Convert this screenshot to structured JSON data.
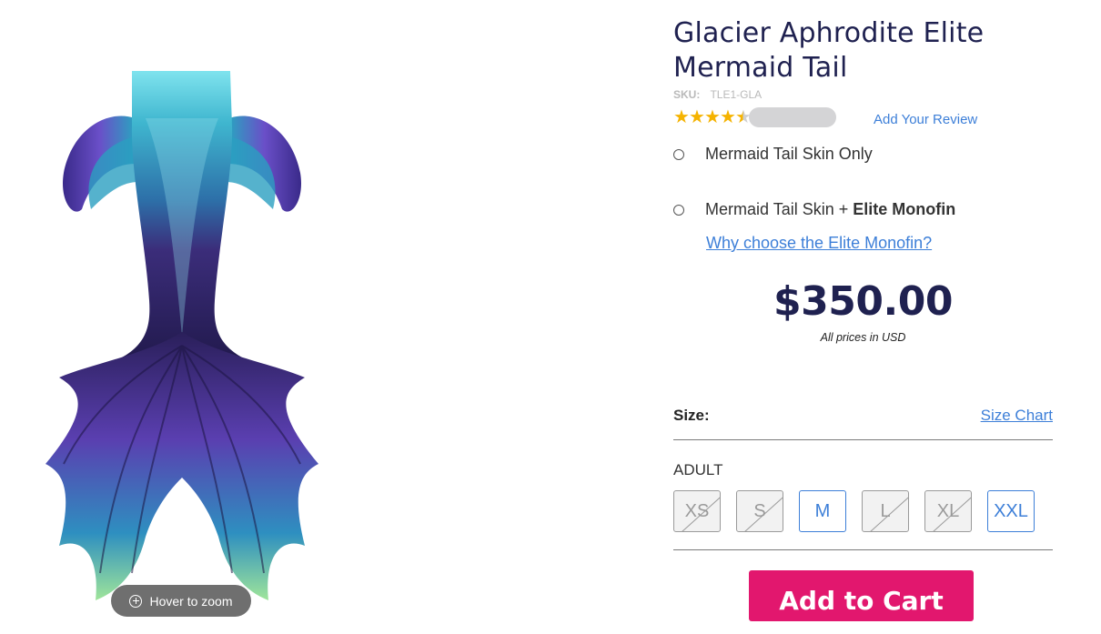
{
  "product": {
    "title": "Glacier Aphrodite Elite Mermaid Tail",
    "sku_label": "SKU:",
    "sku_value": "TLE1-GLA",
    "rating": 4.5,
    "add_review": "Add Your Review"
  },
  "gallery": {
    "zoom_hint": "Hover to zoom",
    "zoom_icon": "zoom-in-icon"
  },
  "options": {
    "option1": "Mermaid Tail Skin Only",
    "option2_prefix": "Mermaid Tail Skin + ",
    "option2_bold": "Elite Monofin",
    "why_link": "Why choose the Elite Monofin?"
  },
  "pricing": {
    "price": "$350.00",
    "note": "All prices in USD"
  },
  "size": {
    "label": "Size:",
    "chart_link": "Size Chart",
    "group": "ADULT",
    "buttons": [
      {
        "label": "XS",
        "available": false
      },
      {
        "label": "S",
        "available": false
      },
      {
        "label": "M",
        "available": true
      },
      {
        "label": "L",
        "available": false
      },
      {
        "label": "XL",
        "available": false
      },
      {
        "label": "XXL",
        "available": true
      }
    ]
  },
  "cart": {
    "label": "Add to Cart"
  },
  "colors": {
    "title": "#1f2150",
    "link": "#3d7fd8",
    "cart": "#e2176e",
    "star": "#f5b301"
  }
}
